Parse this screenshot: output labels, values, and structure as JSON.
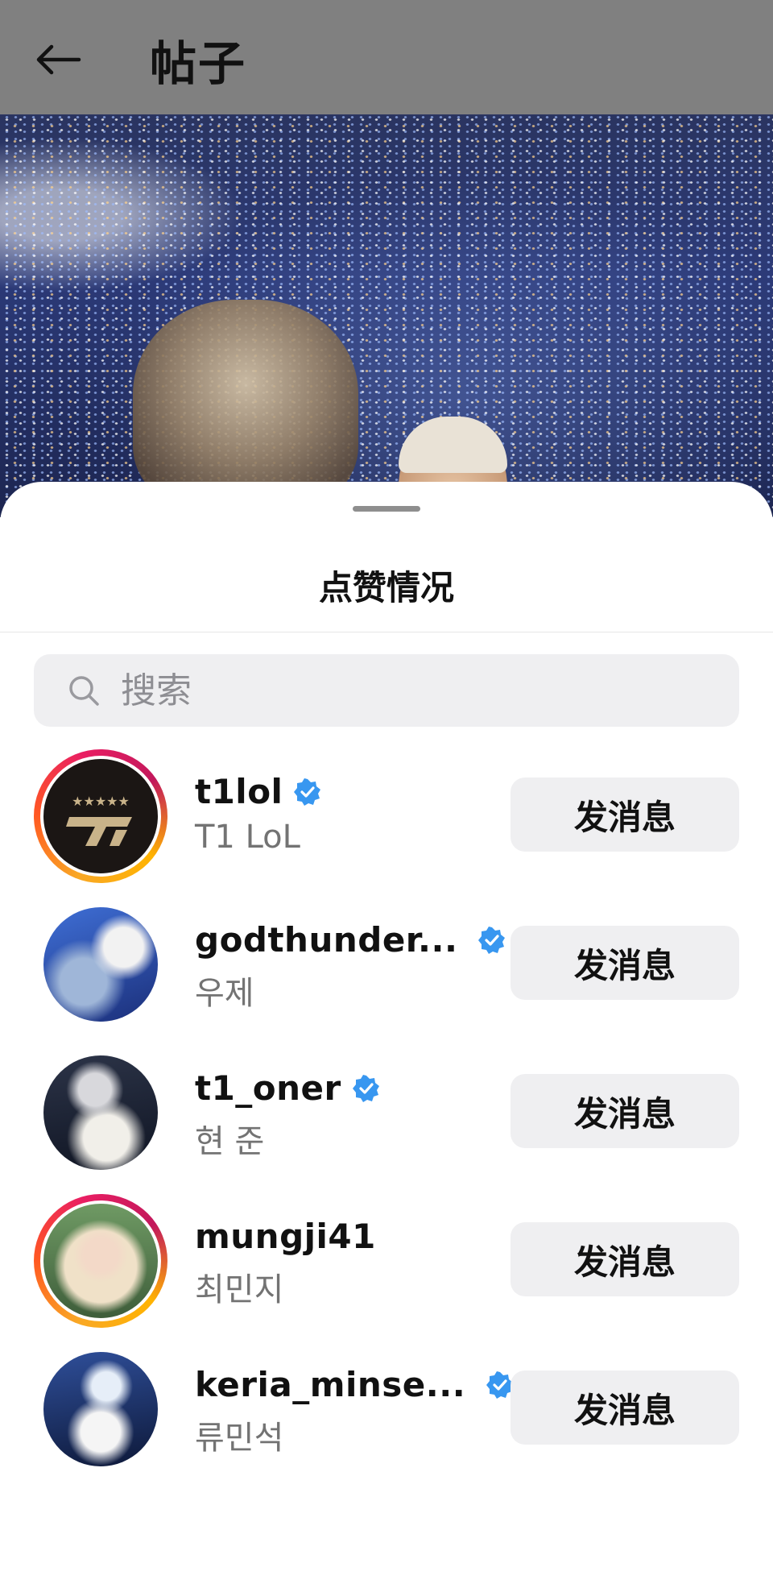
{
  "header": {
    "title": "帖子",
    "back_icon": "back-arrow-icon"
  },
  "sheet": {
    "title": "点赞情况"
  },
  "search": {
    "placeholder": "搜索",
    "value": ""
  },
  "likers": [
    {
      "username": "t1lol",
      "full_name": "T1 LoL",
      "verified": true,
      "has_story": true,
      "action_label": "发消息"
    },
    {
      "username": "godthunder...",
      "full_name": "우제",
      "verified": true,
      "has_story": false,
      "action_label": "发消息"
    },
    {
      "username": "t1_oner",
      "full_name": "현 준",
      "verified": true,
      "has_story": false,
      "action_label": "发消息"
    },
    {
      "username": "mungji41",
      "full_name": "최민지",
      "verified": false,
      "has_story": true,
      "action_label": "发消息"
    },
    {
      "username": "keria_minse...",
      "full_name": "류민석",
      "verified": true,
      "has_story": false,
      "action_label": "发消息"
    }
  ],
  "colors": {
    "verified_blue": "#3897f0",
    "button_bg": "#efeff1",
    "header_dim": "#808080"
  }
}
